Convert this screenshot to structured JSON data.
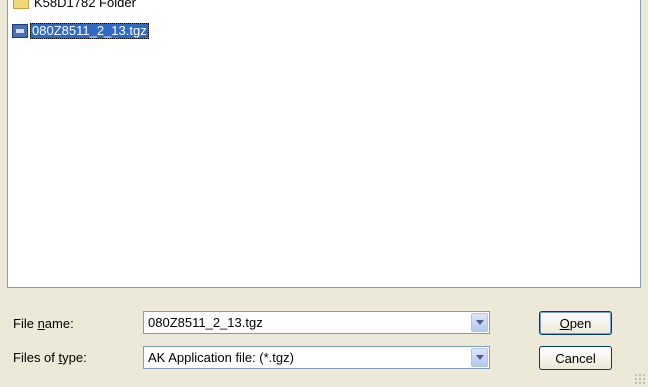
{
  "file_list": {
    "items": [
      {
        "label": "K58D1782 Folder",
        "type": "folder",
        "selected": false
      },
      {
        "label": "080Z8511_2_13.tgz",
        "type": "tgz-file",
        "selected": true
      }
    ]
  },
  "form": {
    "file_name_label_pre": "File ",
    "file_name_label_key": "n",
    "file_name_label_post": "ame:",
    "file_name_value": "080Z8511_2_13.tgz",
    "file_type_label_pre": "Files of ",
    "file_type_label_key": "t",
    "file_type_label_post": "ype:",
    "file_type_value": "AK Application file: (*.tgz)"
  },
  "buttons": {
    "open_key": "O",
    "open_rest": "pen",
    "cancel": "Cancel"
  },
  "colors": {
    "selection": "#316ac5",
    "dialog_bg": "#ece9d8",
    "border": "#7f9db9"
  }
}
